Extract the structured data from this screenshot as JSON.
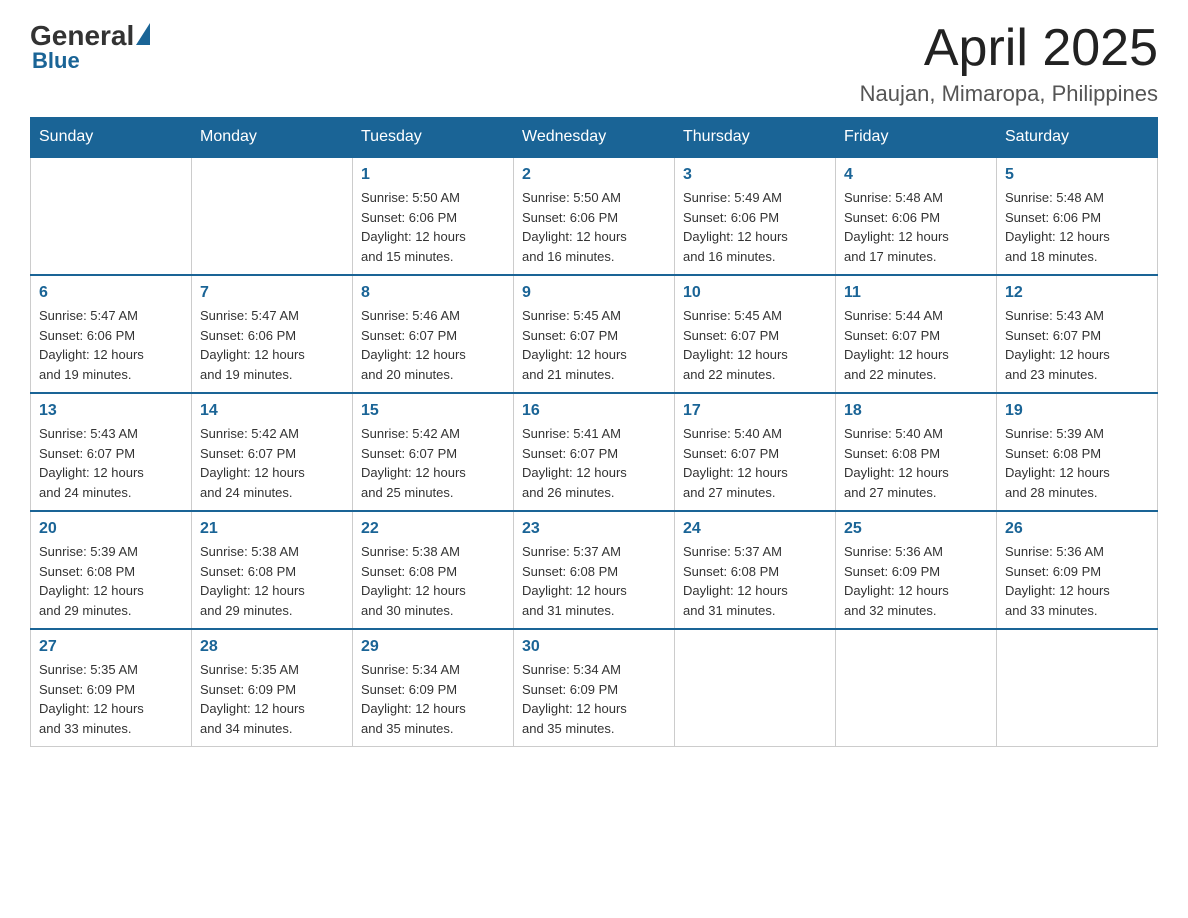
{
  "header": {
    "logo_general": "General",
    "logo_blue": "Blue",
    "month_title": "April 2025",
    "location": "Naujan, Mimaropa, Philippines"
  },
  "calendar": {
    "days_of_week": [
      "Sunday",
      "Monday",
      "Tuesday",
      "Wednesday",
      "Thursday",
      "Friday",
      "Saturday"
    ],
    "weeks": [
      [
        {
          "day": "",
          "info": ""
        },
        {
          "day": "",
          "info": ""
        },
        {
          "day": "1",
          "info": "Sunrise: 5:50 AM\nSunset: 6:06 PM\nDaylight: 12 hours\nand 15 minutes."
        },
        {
          "day": "2",
          "info": "Sunrise: 5:50 AM\nSunset: 6:06 PM\nDaylight: 12 hours\nand 16 minutes."
        },
        {
          "day": "3",
          "info": "Sunrise: 5:49 AM\nSunset: 6:06 PM\nDaylight: 12 hours\nand 16 minutes."
        },
        {
          "day": "4",
          "info": "Sunrise: 5:48 AM\nSunset: 6:06 PM\nDaylight: 12 hours\nand 17 minutes."
        },
        {
          "day": "5",
          "info": "Sunrise: 5:48 AM\nSunset: 6:06 PM\nDaylight: 12 hours\nand 18 minutes."
        }
      ],
      [
        {
          "day": "6",
          "info": "Sunrise: 5:47 AM\nSunset: 6:06 PM\nDaylight: 12 hours\nand 19 minutes."
        },
        {
          "day": "7",
          "info": "Sunrise: 5:47 AM\nSunset: 6:06 PM\nDaylight: 12 hours\nand 19 minutes."
        },
        {
          "day": "8",
          "info": "Sunrise: 5:46 AM\nSunset: 6:07 PM\nDaylight: 12 hours\nand 20 minutes."
        },
        {
          "day": "9",
          "info": "Sunrise: 5:45 AM\nSunset: 6:07 PM\nDaylight: 12 hours\nand 21 minutes."
        },
        {
          "day": "10",
          "info": "Sunrise: 5:45 AM\nSunset: 6:07 PM\nDaylight: 12 hours\nand 22 minutes."
        },
        {
          "day": "11",
          "info": "Sunrise: 5:44 AM\nSunset: 6:07 PM\nDaylight: 12 hours\nand 22 minutes."
        },
        {
          "day": "12",
          "info": "Sunrise: 5:43 AM\nSunset: 6:07 PM\nDaylight: 12 hours\nand 23 minutes."
        }
      ],
      [
        {
          "day": "13",
          "info": "Sunrise: 5:43 AM\nSunset: 6:07 PM\nDaylight: 12 hours\nand 24 minutes."
        },
        {
          "day": "14",
          "info": "Sunrise: 5:42 AM\nSunset: 6:07 PM\nDaylight: 12 hours\nand 24 minutes."
        },
        {
          "day": "15",
          "info": "Sunrise: 5:42 AM\nSunset: 6:07 PM\nDaylight: 12 hours\nand 25 minutes."
        },
        {
          "day": "16",
          "info": "Sunrise: 5:41 AM\nSunset: 6:07 PM\nDaylight: 12 hours\nand 26 minutes."
        },
        {
          "day": "17",
          "info": "Sunrise: 5:40 AM\nSunset: 6:07 PM\nDaylight: 12 hours\nand 27 minutes."
        },
        {
          "day": "18",
          "info": "Sunrise: 5:40 AM\nSunset: 6:08 PM\nDaylight: 12 hours\nand 27 minutes."
        },
        {
          "day": "19",
          "info": "Sunrise: 5:39 AM\nSunset: 6:08 PM\nDaylight: 12 hours\nand 28 minutes."
        }
      ],
      [
        {
          "day": "20",
          "info": "Sunrise: 5:39 AM\nSunset: 6:08 PM\nDaylight: 12 hours\nand 29 minutes."
        },
        {
          "day": "21",
          "info": "Sunrise: 5:38 AM\nSunset: 6:08 PM\nDaylight: 12 hours\nand 29 minutes."
        },
        {
          "day": "22",
          "info": "Sunrise: 5:38 AM\nSunset: 6:08 PM\nDaylight: 12 hours\nand 30 minutes."
        },
        {
          "day": "23",
          "info": "Sunrise: 5:37 AM\nSunset: 6:08 PM\nDaylight: 12 hours\nand 31 minutes."
        },
        {
          "day": "24",
          "info": "Sunrise: 5:37 AM\nSunset: 6:08 PM\nDaylight: 12 hours\nand 31 minutes."
        },
        {
          "day": "25",
          "info": "Sunrise: 5:36 AM\nSunset: 6:09 PM\nDaylight: 12 hours\nand 32 minutes."
        },
        {
          "day": "26",
          "info": "Sunrise: 5:36 AM\nSunset: 6:09 PM\nDaylight: 12 hours\nand 33 minutes."
        }
      ],
      [
        {
          "day": "27",
          "info": "Sunrise: 5:35 AM\nSunset: 6:09 PM\nDaylight: 12 hours\nand 33 minutes."
        },
        {
          "day": "28",
          "info": "Sunrise: 5:35 AM\nSunset: 6:09 PM\nDaylight: 12 hours\nand 34 minutes."
        },
        {
          "day": "29",
          "info": "Sunrise: 5:34 AM\nSunset: 6:09 PM\nDaylight: 12 hours\nand 35 minutes."
        },
        {
          "day": "30",
          "info": "Sunrise: 5:34 AM\nSunset: 6:09 PM\nDaylight: 12 hours\nand 35 minutes."
        },
        {
          "day": "",
          "info": ""
        },
        {
          "day": "",
          "info": ""
        },
        {
          "day": "",
          "info": ""
        }
      ]
    ]
  }
}
